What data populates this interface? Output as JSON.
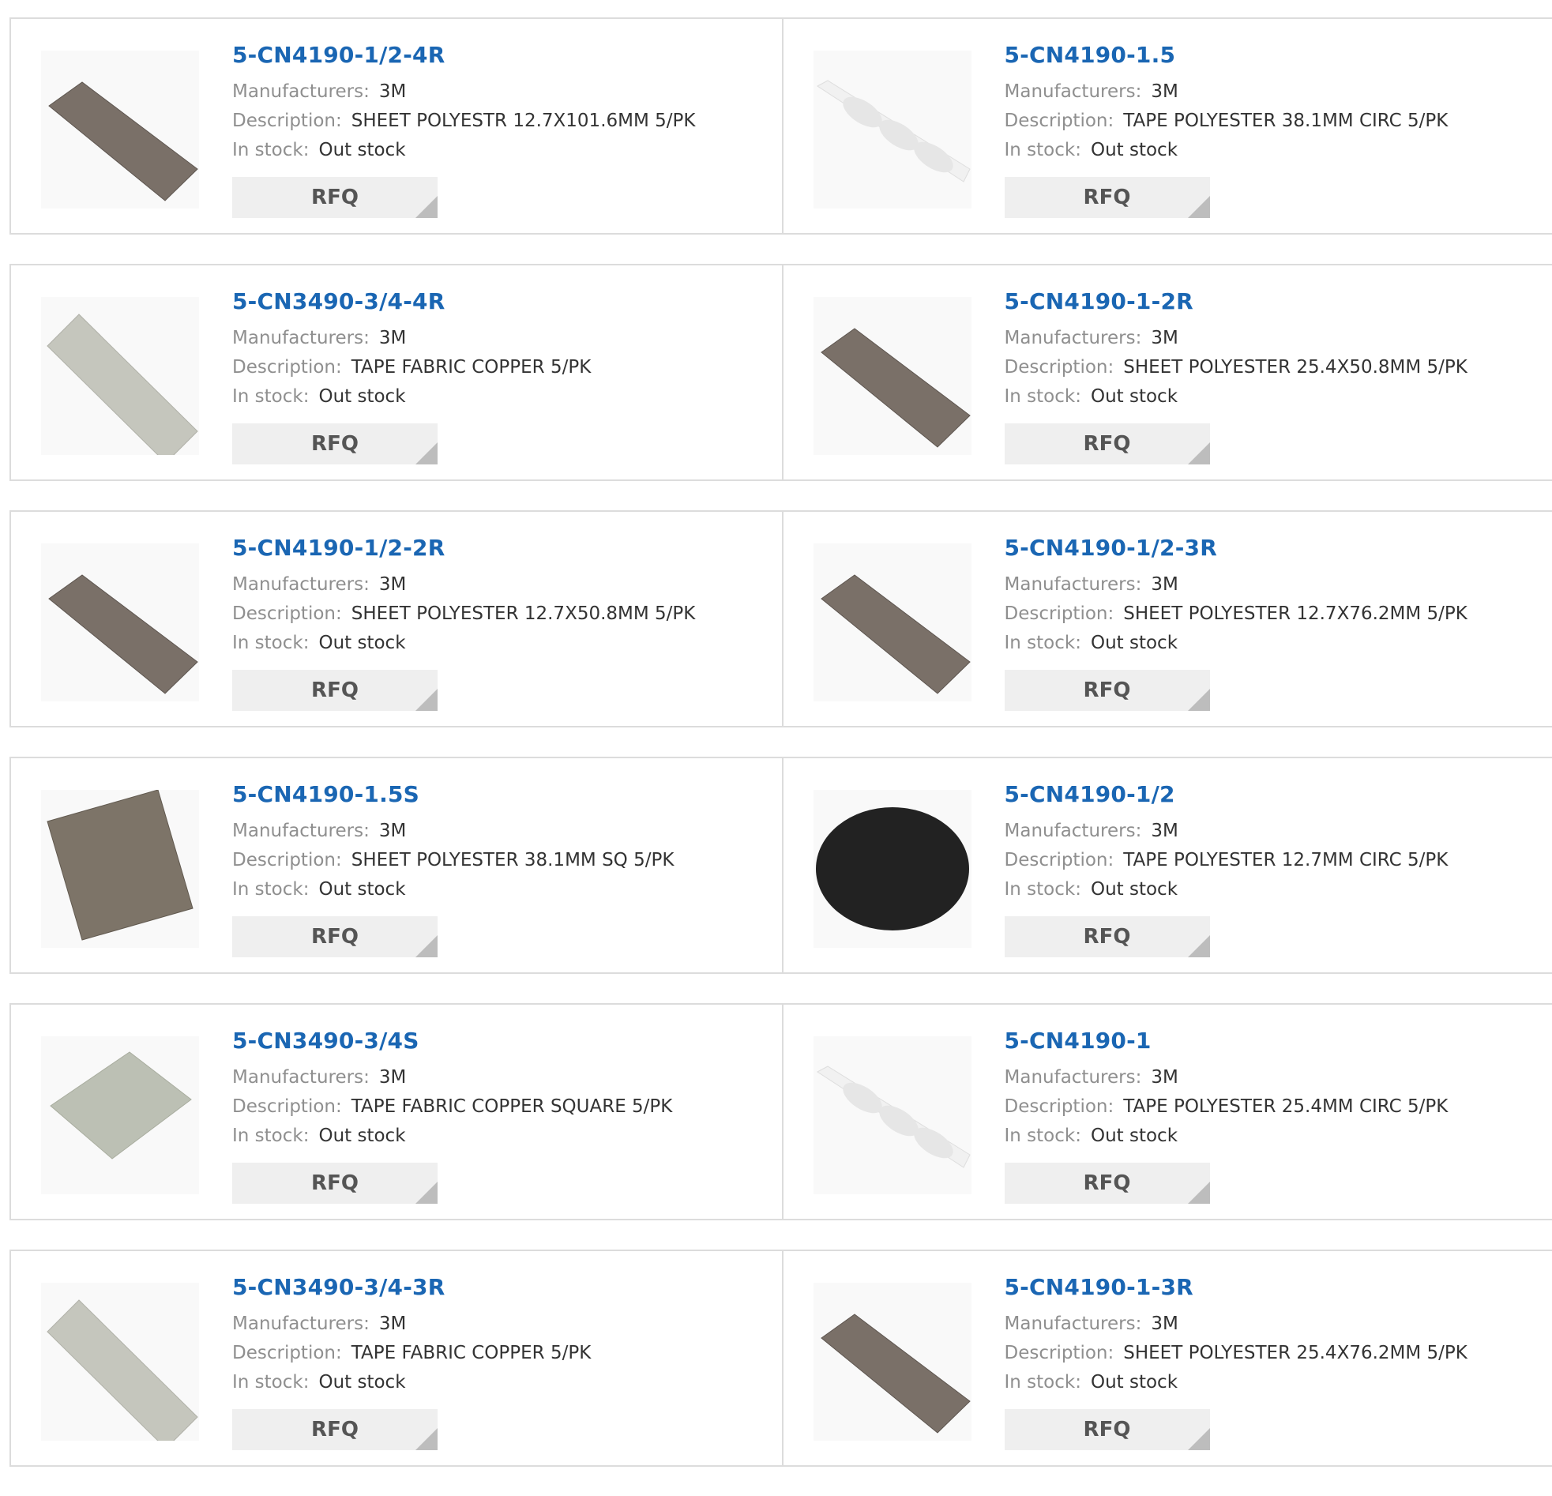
{
  "labels": {
    "manufacturers": "Manufacturers:",
    "description": "Description:",
    "in_stock": "In stock:",
    "rfq": "RFQ"
  },
  "colors": {
    "link": "#1a66b3",
    "label": "#8f8f8f",
    "value": "#333333",
    "border": "#dcdcdc",
    "button_bg": "#efefef"
  },
  "products": [
    {
      "name": "5-CN4190-1/2-4R",
      "manufacturer": "3M",
      "description": "SHEET POLYESTR 12.7X101.6MM 5/PK",
      "stock": "Out stock",
      "image": "dark-strip"
    },
    {
      "name": "5-CN4190-1.5",
      "manufacturer": "3M",
      "description": "TAPE POLYESTER 38.1MM CIRC 5/PK",
      "stock": "Out stock",
      "image": "clear-dots-strip"
    },
    {
      "name": "5-CN3490-3/4-4R",
      "manufacturer": "3M",
      "description": "TAPE FABRIC COPPER 5/PK",
      "stock": "Out stock",
      "image": "fabric-strip"
    },
    {
      "name": "5-CN4190-1-2R",
      "manufacturer": "3M",
      "description": "SHEET POLYESTER 25.4X50.8MM 5/PK",
      "stock": "Out stock",
      "image": "dark-strip"
    },
    {
      "name": "5-CN4190-1/2-2R",
      "manufacturer": "3M",
      "description": "SHEET POLYESTER 12.7X50.8MM 5/PK",
      "stock": "Out stock",
      "image": "dark-strip"
    },
    {
      "name": "5-CN4190-1/2-3R",
      "manufacturer": "3M",
      "description": "SHEET POLYESTER 12.7X76.2MM 5/PK",
      "stock": "Out stock",
      "image": "dark-strip"
    },
    {
      "name": "5-CN4190-1.5S",
      "manufacturer": "3M",
      "description": "SHEET POLYESTER 38.1MM SQ 5/PK",
      "stock": "Out stock",
      "image": "dark-square"
    },
    {
      "name": "5-CN4190-1/2",
      "manufacturer": "3M",
      "description": "TAPE POLYESTER 12.7MM CIRC 5/PK",
      "stock": "Out stock",
      "image": "black-circle"
    },
    {
      "name": "5-CN3490-3/4S",
      "manufacturer": "3M",
      "description": "TAPE FABRIC COPPER SQUARE 5/PK",
      "stock": "Out stock",
      "image": "fabric-square"
    },
    {
      "name": "5-CN4190-1",
      "manufacturer": "3M",
      "description": "TAPE POLYESTER 25.4MM CIRC 5/PK",
      "stock": "Out stock",
      "image": "clear-dots-strip"
    },
    {
      "name": "5-CN3490-3/4-3R",
      "manufacturer": "3M",
      "description": "TAPE FABRIC COPPER 5/PK",
      "stock": "Out stock",
      "image": "fabric-strip"
    },
    {
      "name": "5-CN4190-1-3R",
      "manufacturer": "3M",
      "description": "SHEET POLYESTER 25.4X76.2MM 5/PK",
      "stock": "Out stock",
      "image": "dark-strip"
    }
  ]
}
